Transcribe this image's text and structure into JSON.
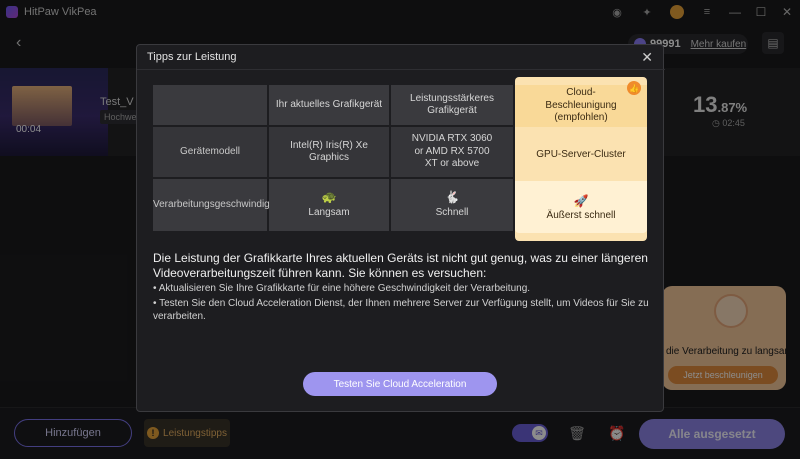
{
  "app": {
    "title": "HitPaw VikPea"
  },
  "header": {
    "coins": "99991",
    "buy_label": "Mehr kaufen"
  },
  "job": {
    "duration": "00:04",
    "name": "Test_V",
    "badge": "Hochwe",
    "progress_main": "13",
    "progress_decimal": ".87%",
    "eta": "02:45"
  },
  "promo": {
    "text": "die Verarbeitung zu langsam",
    "button": "Jetzt beschleunigen"
  },
  "bottom": {
    "add_label": "Hinzufügen",
    "tips_label": "Leistungstipps",
    "pause_all_label": "Alle ausgesetzt"
  },
  "modal": {
    "title": "Tipps zur Leistung",
    "columns": {
      "current": "Ihr aktuelles Grafikgerät",
      "stronger": "Leistungsstärkeres Grafikgerät",
      "cloud": "Cloud-Beschleunigung (empfohlen)"
    },
    "rows": {
      "model_label": "Gerätemodell",
      "model_current": "Intel(R) Iris(R) Xe Graphics",
      "model_stronger": "NVIDIA RTX 3060 or AMD RX 5700 XT or above",
      "model_cloud": "GPU-Server-Cluster",
      "speed_label": "Verarbeitungsgeschwindigkeit",
      "speed_current": "Langsam",
      "speed_stronger": "Schnell",
      "speed_cloud": "Äußerst schnell"
    },
    "description": "Die Leistung der Grafikkarte Ihres aktuellen Geräts ist nicht gut genug, was zu einer längeren Videoverarbeitungszeit führen kann. Sie können es versuchen:",
    "bullet1": "• Aktualisieren Sie Ihre Grafikkarte für eine höhere Geschwindigkeit der Verarbeitung.",
    "bullet2": "• Testen Sie den Cloud Acceleration Dienst, der Ihnen mehrere Server zur Verfügung stellt, um Videos für Sie zu verarbeiten.",
    "cta_label": "Testen Sie Cloud Acceleration"
  },
  "colors": {
    "accent": "#8c84e6",
    "cloud_highlight": "#fbe2b1",
    "warning": "#e6a23a"
  }
}
